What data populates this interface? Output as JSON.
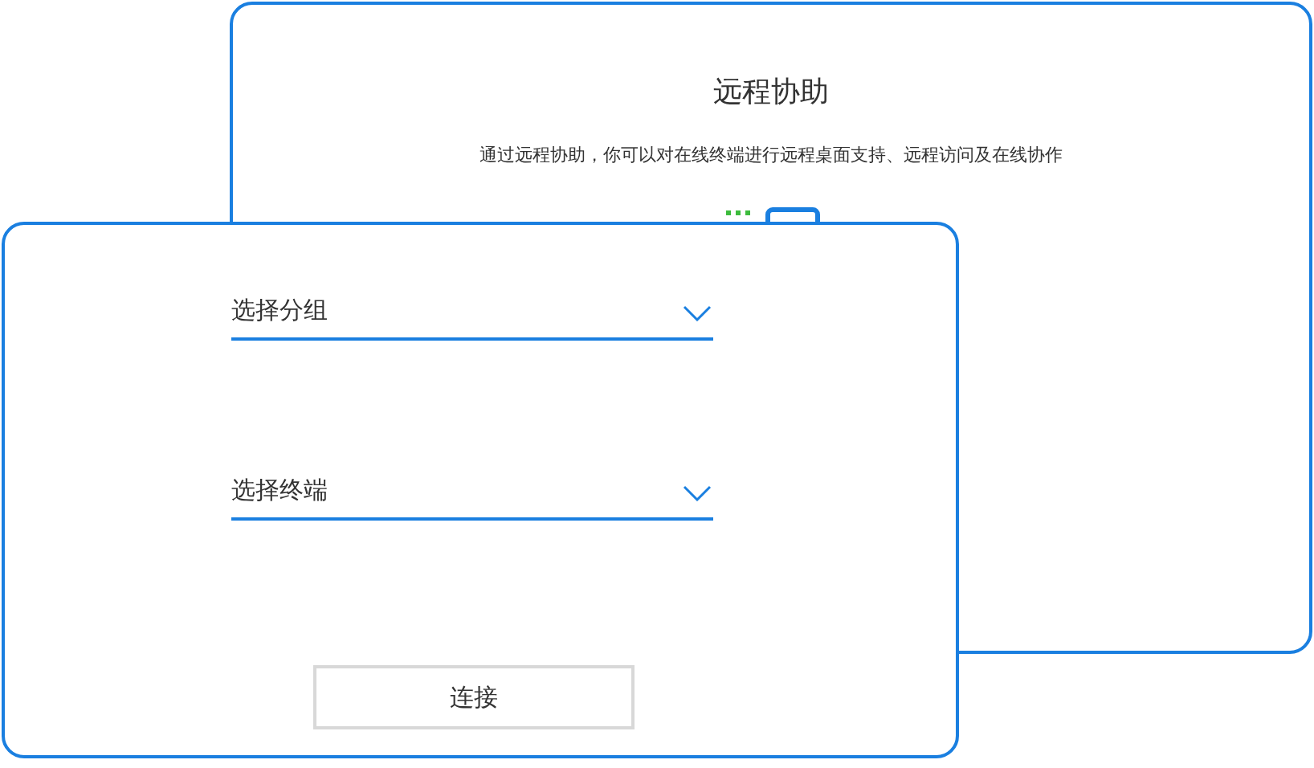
{
  "back_card": {
    "title": "远程协助",
    "description": "通过远程协助，你可以对在线终端进行远程桌面支持、远程访问及在线协作"
  },
  "front_card": {
    "selects": [
      {
        "placeholder": "选择分组"
      },
      {
        "placeholder": "选择终端"
      }
    ],
    "button": "连接"
  }
}
